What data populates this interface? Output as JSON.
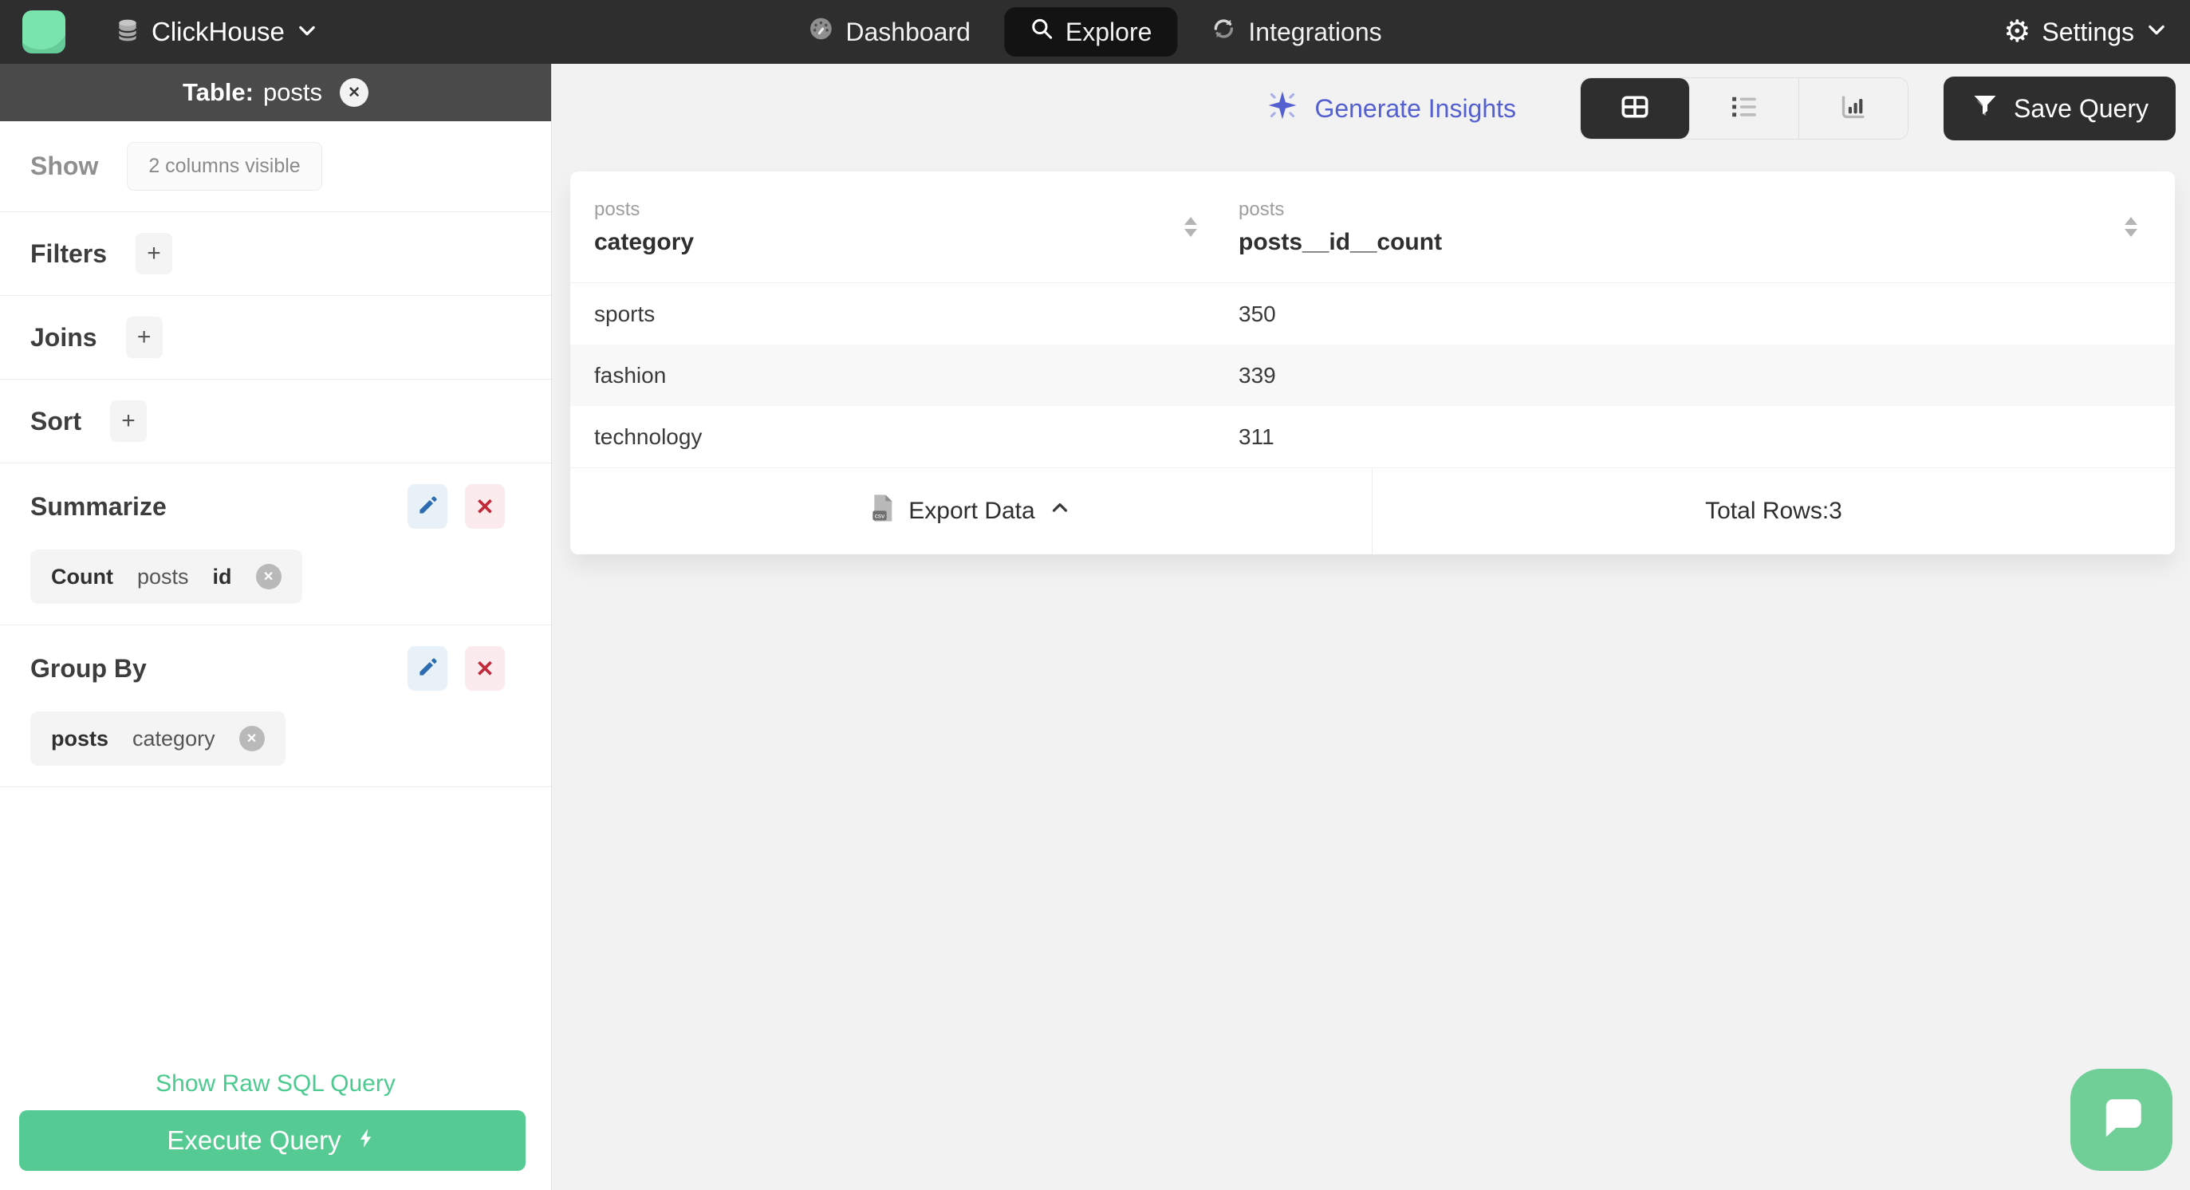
{
  "navbar": {
    "brand": "ClickHouse",
    "items": [
      {
        "label": "Dashboard"
      },
      {
        "label": "Explore"
      },
      {
        "label": "Integrations"
      }
    ],
    "settings": "Settings"
  },
  "sidebar": {
    "header": {
      "prefix": "Table:",
      "table": "posts",
      "close": "✕"
    },
    "show_label": "Show",
    "show_badge": "2 columns visible",
    "filters_label": "Filters",
    "joins_label": "Joins",
    "sort_label": "Sort",
    "add": "+",
    "summarize": {
      "label": "Summarize",
      "chip_agg": "Count",
      "chip_table": "posts",
      "chip_column": "id",
      "delete": "✕",
      "chip_remove": "✕"
    },
    "group_by": {
      "label": "Group By",
      "chip_table": "posts",
      "chip_column": "category",
      "delete": "✕",
      "chip_remove": "✕"
    },
    "raw_sql": "Show Raw SQL Query",
    "execute": "Execute Query"
  },
  "toolbar": {
    "insights": "Generate Insights",
    "save": "Save Query"
  },
  "table": {
    "col1": {
      "table": "posts",
      "name": "category"
    },
    "col2": {
      "table": "posts",
      "name": "posts__id__count"
    },
    "rows": [
      {
        "category": "sports",
        "count": "350"
      },
      {
        "category": "fashion",
        "count": "339"
      },
      {
        "category": "technology",
        "count": "311"
      }
    ],
    "export": "Export Data",
    "total": "Total Rows:3"
  },
  "icons": {
    "gear": "⚙"
  },
  "colors": {
    "navbar_bg": "#2e2e2e",
    "sidebar_header_bg": "#4a4a4a",
    "brand_green": "#79e4ad",
    "button_green": "#55cb93",
    "link_green": "#4ccb90",
    "insights_indigo": "#5560d0",
    "edit_blue": "#2e6cb0",
    "danger_red": "#c1293a"
  }
}
